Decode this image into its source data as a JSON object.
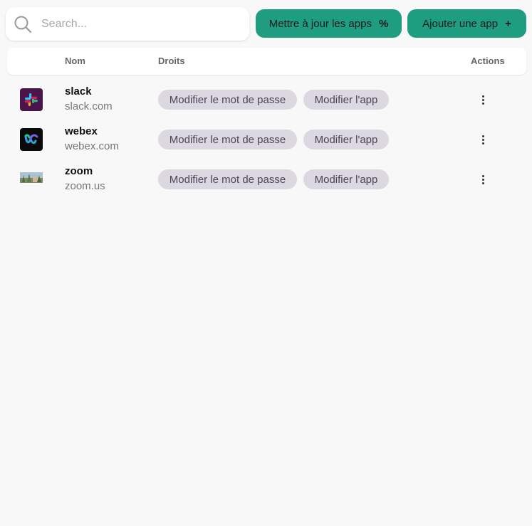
{
  "search": {
    "placeholder": "Search..."
  },
  "toolbar": {
    "update_label": "Mettre à jour les apps",
    "update_icon": "percent-icon",
    "update_glyph": "%",
    "add_label": "Ajouter une app",
    "add_icon": "plus-icon",
    "add_glyph": "+",
    "accent": "#1f9d80"
  },
  "table": {
    "headers": {
      "nom": "Nom",
      "droits": "Droits",
      "actions": "Actions"
    },
    "rows": [
      {
        "name": "slack",
        "domain": "slack.com",
        "logo": "slack-logo",
        "rights": [
          "Modifier le mot de passe",
          "Modifier l'app"
        ]
      },
      {
        "name": "webex",
        "domain": "webex.com",
        "logo": "webex-logo",
        "rights": [
          "Modifier le mot de passe",
          "Modifier l'app"
        ]
      },
      {
        "name": "zoom",
        "domain": "zoom.us",
        "logo": "zoom-logo",
        "rights": [
          "Modifier le mot de passe",
          "Modifier l'app"
        ]
      }
    ]
  }
}
